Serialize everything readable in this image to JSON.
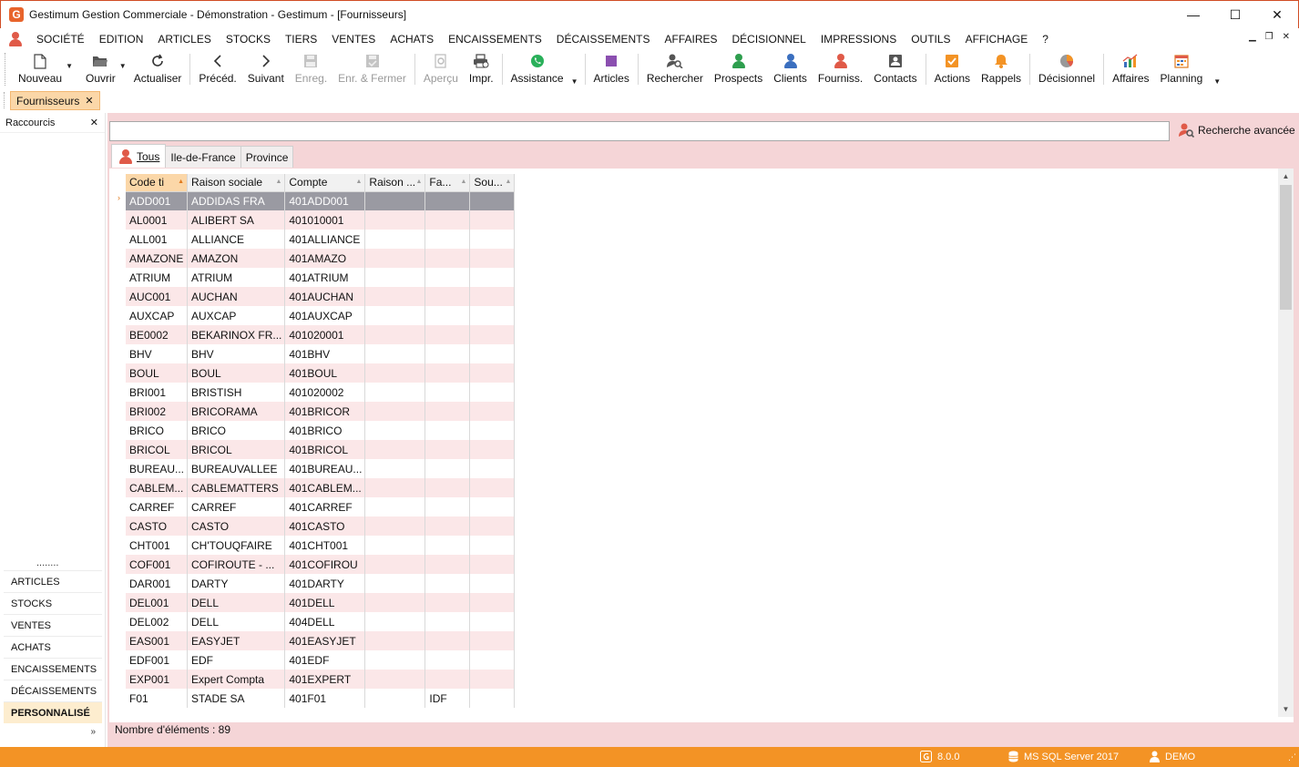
{
  "window": {
    "title": "Gestimum Gestion Commerciale - Démonstration - Gestimum - [Fournisseurs]",
    "logo_letter": "G",
    "controls": {
      "minimize": "—",
      "maximize": "☐",
      "close": "✕"
    },
    "mdi_controls": {
      "minimize": "▁",
      "restore": "❐",
      "close": "✕"
    }
  },
  "menu": {
    "items": [
      "SOCIÉTÉ",
      "EDITION",
      "ARTICLES",
      "STOCKS",
      "TIERS",
      "VENTES",
      "ACHATS",
      "ENCAISSEMENTS",
      "DÉCAISSEMENTS",
      "AFFAIRES",
      "DÉCISIONNEL",
      "IMPRESSIONS",
      "OUTILS",
      "AFFICHAGE",
      "?"
    ]
  },
  "toolbar": {
    "nouveau": "Nouveau",
    "ouvrir": "Ouvrir",
    "actualiser": "Actualiser",
    "preced": "Précéd.",
    "suivant": "Suivant",
    "enreg": "Enreg.",
    "enreg_fermer": "Enr. & Fermer",
    "apercu": "Aperçu",
    "impr": "Impr.",
    "assistance": "Assistance",
    "articles": "Articles",
    "rechercher": "Rechercher",
    "prospects": "Prospects",
    "clients": "Clients",
    "fourniss": "Fourniss.",
    "contacts": "Contacts",
    "actions": "Actions",
    "rappels": "Rappels",
    "decisionnel": "Décisionnel",
    "affaires": "Affaires",
    "planning": "Planning"
  },
  "colors": {
    "accent_orange": "#f39325",
    "panel_pink": "#f5d5d7",
    "row_alt": "#fbe7e8",
    "selected_row": "#9a9aa2",
    "tab_orange": "#fbd7a8"
  },
  "doc_tab": {
    "label": "Fournisseurs",
    "close": "✕"
  },
  "sidebar": {
    "title": "Raccourcis",
    "close": "✕",
    "dots": "........",
    "items": [
      "ARTICLES",
      "STOCKS",
      "VENTES",
      "ACHATS",
      "ENCAISSEMENTS",
      "DÉCAISSEMENTS",
      "PERSONNALISÉ"
    ],
    "expand": "»"
  },
  "search": {
    "value": "",
    "advanced_label": "Recherche avancée"
  },
  "tabs": [
    "Tous",
    "Ile-de-France",
    "Province"
  ],
  "grid": {
    "columns": [
      "Code ti",
      "Raison sociale",
      "Compte",
      "Raison ...",
      "Fa...",
      "Sou..."
    ],
    "rows": [
      [
        "ADD001",
        "ADDIDAS FRA",
        "401ADD001",
        "",
        "",
        ""
      ],
      [
        "AL0001",
        "ALIBERT SA",
        "401010001",
        "",
        "",
        ""
      ],
      [
        "ALL001",
        "ALLIANCE",
        "401ALLIANCE",
        "",
        "",
        ""
      ],
      [
        "AMAZONE",
        "AMAZON",
        "401AMAZO",
        "",
        "",
        ""
      ],
      [
        "ATRIUM",
        "ATRIUM",
        "401ATRIUM",
        "",
        "",
        ""
      ],
      [
        "AUC001",
        "AUCHAN",
        "401AUCHAN",
        "",
        "",
        ""
      ],
      [
        "AUXCAP",
        "AUXCAP",
        "401AUXCAP",
        "",
        "",
        ""
      ],
      [
        "BE0002",
        "BEKARINOX FR...",
        "401020001",
        "",
        "",
        ""
      ],
      [
        "BHV",
        "BHV",
        "401BHV",
        "",
        "",
        ""
      ],
      [
        "BOUL",
        "BOUL",
        "401BOUL",
        "",
        "",
        ""
      ],
      [
        "BRI001",
        "BRISTISH",
        "401020002",
        "",
        "",
        ""
      ],
      [
        "BRI002",
        "BRICORAMA",
        "401BRICOR",
        "",
        "",
        ""
      ],
      [
        "BRICO",
        "BRICO",
        "401BRICO",
        "",
        "",
        ""
      ],
      [
        "BRICOL",
        "BRICOL",
        "401BRICOL",
        "",
        "",
        ""
      ],
      [
        "BUREAU...",
        "BUREAUVALLEE",
        "401BUREAU...",
        "",
        "",
        ""
      ],
      [
        "CABLEM...",
        "CABLEMATTERS",
        "401CABLEM...",
        "",
        "",
        ""
      ],
      [
        "CARREF",
        "CARREF",
        "401CARREF",
        "",
        "",
        ""
      ],
      [
        "CASTO",
        "CASTO",
        "401CASTO",
        "",
        "",
        ""
      ],
      [
        "CHT001",
        "CH'TOUQFAIRE",
        "401CHT001",
        "",
        "",
        ""
      ],
      [
        "COF001",
        "COFIROUTE - ...",
        "401COFIROU",
        "",
        "",
        ""
      ],
      [
        "DAR001",
        "DARTY",
        "401DARTY",
        "",
        "",
        ""
      ],
      [
        "DEL001",
        "DELL",
        "401DELL",
        "",
        "",
        ""
      ],
      [
        "DEL002",
        "DELL",
        "404DELL",
        "",
        "",
        ""
      ],
      [
        "EAS001",
        "EASYJET",
        "401EASYJET",
        "",
        "",
        ""
      ],
      [
        "EDF001",
        "EDF",
        "401EDF",
        "",
        "",
        ""
      ],
      [
        "EXP001",
        "Expert Compta",
        "401EXPERT",
        "",
        "",
        ""
      ],
      [
        "F01",
        "STADE SA",
        "401F01",
        "",
        "IDF",
        ""
      ]
    ],
    "selected_row": 0,
    "row_indicator": "›",
    "count_label": "Nombre d'éléments : 89"
  },
  "status": {
    "version": "8.0.0",
    "db": "MS SQL Server 2017",
    "user": "DEMO"
  }
}
